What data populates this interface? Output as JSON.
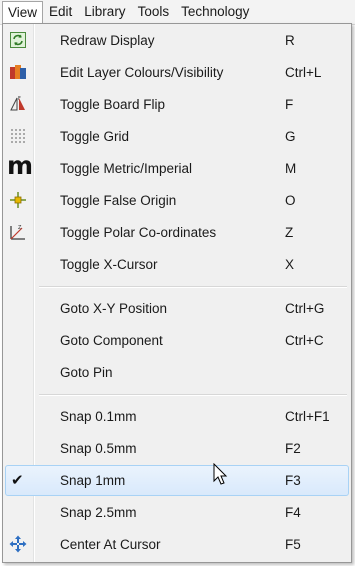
{
  "menubar": {
    "items": [
      {
        "label": "View"
      },
      {
        "label": "Edit"
      },
      {
        "label": "Library"
      },
      {
        "label": "Tools"
      },
      {
        "label": "Technology"
      }
    ]
  },
  "menu": {
    "items": [
      {
        "label": "Redraw Display",
        "shortcut": "R",
        "icon": "redraw-icon"
      },
      {
        "label": "Edit Layer Colours/Visibility",
        "shortcut": "Ctrl+L",
        "icon": "layers-icon"
      },
      {
        "label": "Toggle Board Flip",
        "shortcut": "F",
        "icon": "flip-icon"
      },
      {
        "label": "Toggle Grid",
        "shortcut": "G",
        "icon": "grid-icon"
      },
      {
        "label": "Toggle Metric/Imperial",
        "shortcut": "M",
        "icon": "metric-icon",
        "icon_text": "m"
      },
      {
        "label": "Toggle False Origin",
        "shortcut": "O",
        "icon": "origin-icon"
      },
      {
        "label": "Toggle Polar Co-ordinates",
        "shortcut": "Z",
        "icon": "polar-icon"
      },
      {
        "label": "Toggle X-Cursor",
        "shortcut": "X",
        "icon": ""
      },
      {
        "label": "Goto X-Y Position",
        "shortcut": "Ctrl+G",
        "icon": ""
      },
      {
        "label": "Goto Component",
        "shortcut": "Ctrl+C",
        "icon": ""
      },
      {
        "label": "Goto Pin",
        "shortcut": "",
        "icon": ""
      },
      {
        "label": "Snap 0.1mm",
        "shortcut": "Ctrl+F1",
        "icon": ""
      },
      {
        "label": "Snap 0.5mm",
        "shortcut": "F2",
        "icon": ""
      },
      {
        "label": "Snap 1mm",
        "shortcut": "F3",
        "icon": "checkmark-icon",
        "checked": true,
        "hovered": true
      },
      {
        "label": "Snap 2.5mm",
        "shortcut": "F4",
        "icon": ""
      },
      {
        "label": "Center At Cursor",
        "shortcut": "F5",
        "icon": "center-cursor-icon"
      }
    ],
    "check_glyph": "✔",
    "highlight_color": "#d9e9fb",
    "highlight_border": "#a8d2f5"
  }
}
